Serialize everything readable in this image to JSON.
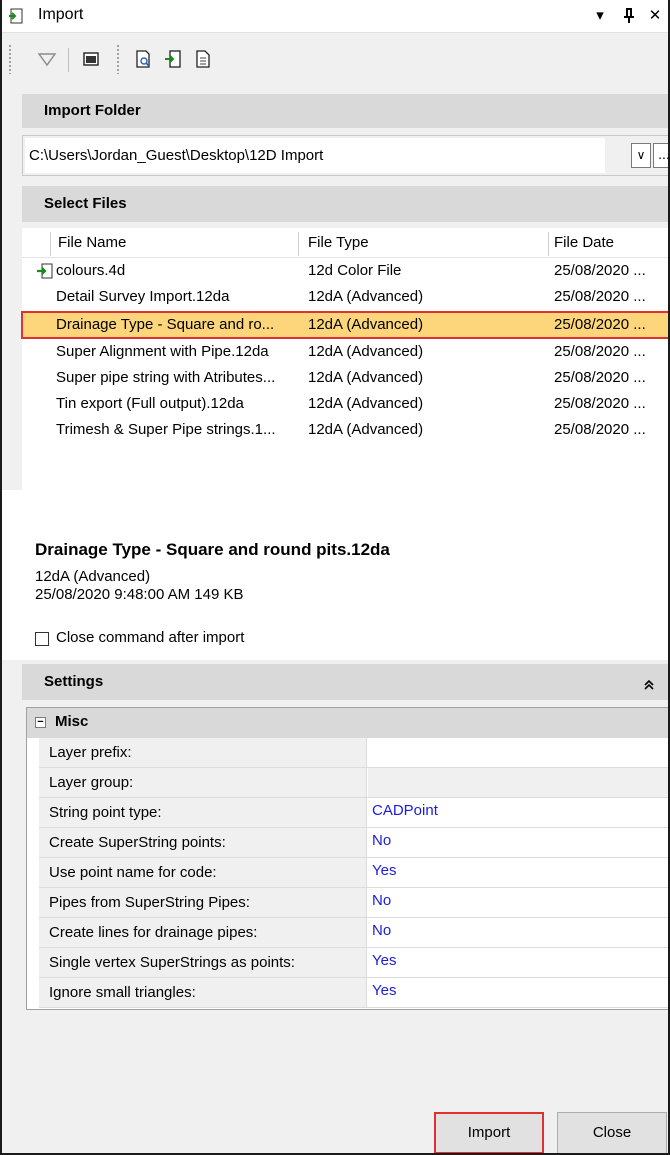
{
  "window": {
    "title": "Import",
    "dropdown_glyph": "▾",
    "pin_glyph": "ꟸ",
    "close_glyph": "✕"
  },
  "toolbar": {
    "icons": [
      "filter-icon",
      "terminal-icon",
      "preview-icon",
      "import-icon",
      "document-icon"
    ]
  },
  "import_folder": {
    "header": "Import Folder",
    "path": "C:\\Users\\Jordan_Guest\\Desktop\\12D Import",
    "dropdown_glyph": "∨",
    "browse_label": "..."
  },
  "select_files": {
    "header": "Select Files",
    "columns": [
      "File Name",
      "File Type",
      "File Date"
    ],
    "rows": [
      {
        "name": "colours.4d",
        "type": "12d Color File",
        "date": "25/08/2020 ..."
      },
      {
        "name": "Detail Survey Import.12da",
        "type": "12dA (Advanced)",
        "date": "25/08/2020 ..."
      },
      {
        "name": "Drainage Type - Square and ro...",
        "type": "12dA (Advanced)",
        "date": "25/08/2020 ..."
      },
      {
        "name": "Super Alignment with Pipe.12da",
        "type": "12dA (Advanced)",
        "date": "25/08/2020 ..."
      },
      {
        "name": "Super pipe string with Atributes...",
        "type": "12dA (Advanced)",
        "date": "25/08/2020 ..."
      },
      {
        "name": "Tin export (Full output).12da",
        "type": "12dA (Advanced)",
        "date": "25/08/2020 ..."
      },
      {
        "name": "Trimesh & Super Pipe strings.1...",
        "type": "12dA (Advanced)",
        "date": "25/08/2020 ..."
      }
    ],
    "selected_index": 2
  },
  "details": {
    "title": "Drainage Type - Square and round pits.12da",
    "type": "12dA (Advanced)",
    "date_size": "25/08/2020 9:48:00 AM  149 KB"
  },
  "close_after_import": {
    "label": "Close command after import",
    "checked": false
  },
  "settings": {
    "header": "Settings",
    "collapse_glyph": "≈",
    "group": "Misc",
    "group_glyph": "−",
    "properties": [
      {
        "name": "Layer prefix:",
        "value": ""
      },
      {
        "name": "Layer group:",
        "value": ""
      },
      {
        "name": "String point type:",
        "value": "CADPoint"
      },
      {
        "name": "Create SuperString points:",
        "value": "No"
      },
      {
        "name": "Use point name for code:",
        "value": "Yes"
      },
      {
        "name": "Pipes from SuperString Pipes:",
        "value": "No"
      },
      {
        "name": "Create lines for drainage pipes:",
        "value": "No"
      },
      {
        "name": "Single vertex SuperStrings as points:",
        "value": "Yes"
      },
      {
        "name": "Ignore small triangles:",
        "value": "Yes"
      }
    ]
  },
  "buttons": {
    "import_label": "Import",
    "close_label": "Close"
  }
}
